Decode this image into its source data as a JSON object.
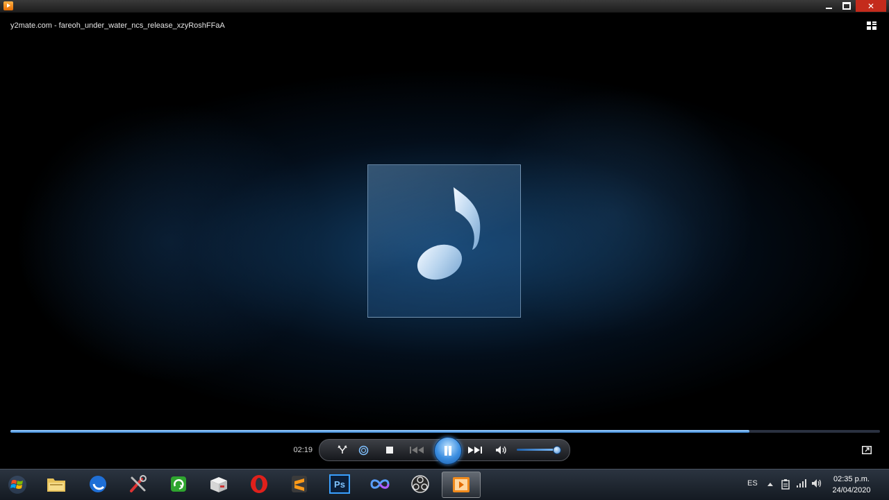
{
  "window": {
    "title_text": "",
    "minimize_symbol": "",
    "maximize_symbol": "",
    "close_symbol": "✕"
  },
  "player": {
    "media_title": "y2mate.com - fareoh_under_water_ncs_release_xzyRoshFFaA",
    "elapsed_time": "02:19",
    "seek_progress_percent": 85,
    "volume_percent": 95,
    "state": "playing",
    "album_art_icon": "music-note-icon"
  },
  "controls": {
    "shuffle_icon": "shuffle-icon",
    "repeat_icon": "repeat-icon",
    "stop_icon": "stop-icon",
    "previous_icon": "previous-icon",
    "play_pause_icon": "pause-icon",
    "next_icon": "next-icon",
    "mute_icon": "speaker-icon"
  },
  "taskbar": {
    "items": [
      {
        "name": "file-explorer",
        "icon": "folder-icon"
      },
      {
        "name": "browser",
        "icon": "globe-icon"
      },
      {
        "name": "tools",
        "icon": "tools-icon"
      },
      {
        "name": "refresh-app",
        "icon": "recycle-icon"
      },
      {
        "name": "box-app",
        "icon": "box-icon"
      },
      {
        "name": "opera",
        "icon": "opera-icon"
      },
      {
        "name": "sublime-text",
        "icon": "sublime-icon"
      },
      {
        "name": "photoshop",
        "icon": "photoshop-icon",
        "label": "Ps"
      },
      {
        "name": "infinity-app",
        "icon": "infinity-icon"
      },
      {
        "name": "obs",
        "icon": "obs-icon"
      },
      {
        "name": "media-player",
        "icon": "media-player-icon",
        "active": true
      }
    ],
    "language": "ES",
    "clock_time": "02:35 p.m.",
    "clock_date": "24/04/2020"
  },
  "colors": {
    "accent": "#3a87d6",
    "close_button": "#c42b1c",
    "opera_red": "#e0201b",
    "sublime_orange": "#ff9a18"
  }
}
